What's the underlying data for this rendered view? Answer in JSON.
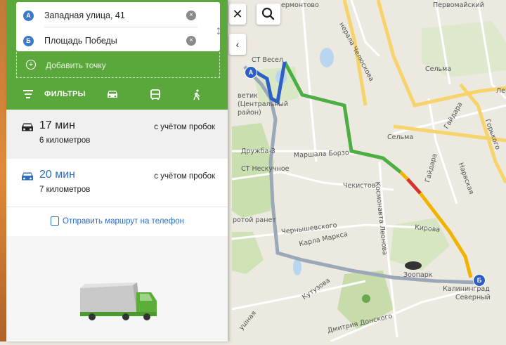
{
  "route_form": {
    "point_a": {
      "badge": "А",
      "value": "Западная улица, 41"
    },
    "point_b": {
      "badge": "Б",
      "value": "Площадь Победы"
    },
    "add_point_label": "Добавить точку"
  },
  "tabs": {
    "filters_label": "ФИЛЬТРЫ",
    "active": "car"
  },
  "routes": [
    {
      "time": "17 мин",
      "distance": "6 километров",
      "traffic": "с учётом пробок",
      "selected": true
    },
    {
      "time": "20 мин",
      "distance": "7 километров",
      "traffic": "с учётом пробок",
      "selected": false
    }
  ],
  "send_route_label": "Отправить маршрут на телефон",
  "map_controls": {
    "close": "✕",
    "collapse": "‹"
  },
  "map": {
    "markers": {
      "start": "А",
      "end": "Б"
    },
    "labels": {
      "top_street": "ермонтово",
      "pervomayskiy": "Первомайский",
      "chelyuskintsev": "нерала Челюскова",
      "st_vesel": "СТ Весел",
      "sel_ma_top": "Сельма",
      "district": "ветик (Центральный район)",
      "len": "Лен",
      "gaidara_upper": "Гайдара",
      "gorkogo": "Горького",
      "sel_ma": "Сельма",
      "druzhba": "Дружба-3",
      "marshala": "Маршала Борзо",
      "st_neskuchnoe": "СТ Нескучное",
      "gaidara": "Гайдара",
      "narvskaya": "Нарвская",
      "chekistov": "Чекистов",
      "kosmonavta": "Космонавта Леонова",
      "ranet": "ротой ранет",
      "chernyshevskogo": "Чернышевского",
      "karla_marksa": "Карла Маркса",
      "kirova": "Кирова",
      "zoopark": "Зоопарк",
      "kutuzova": "Кутузова",
      "kaliningrad": "Калининград",
      "severny": "Северный",
      "dmitriya": "Дмитрия Донского",
      "nya": "ушная"
    },
    "colors": {
      "route_main": "#4cae43",
      "route_alt": "#9aa8b8",
      "traffic_yellow": "#f0b400",
      "traffic_red": "#d9322b",
      "start_seg": "#2d5fc4"
    }
  }
}
